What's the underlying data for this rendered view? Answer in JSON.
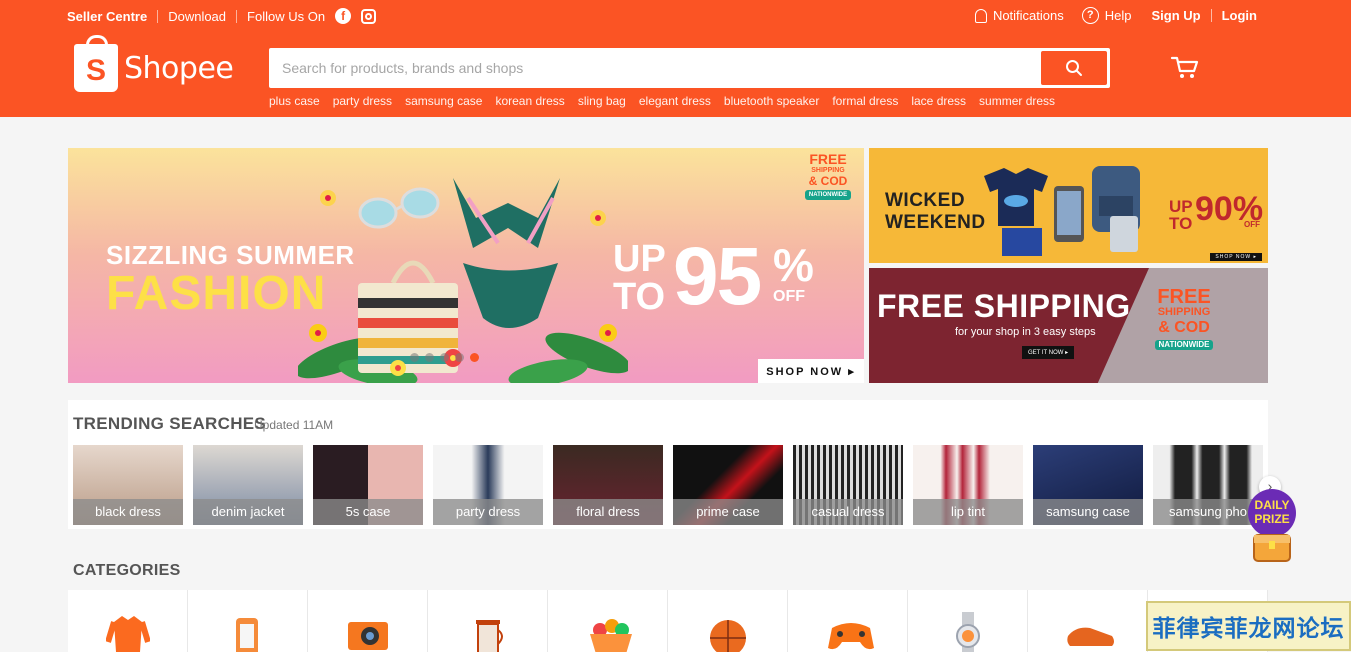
{
  "topbar": {
    "seller_centre": "Seller Centre",
    "download": "Download",
    "follow_us": "Follow Us On",
    "notifications": "Notifications",
    "help": "Help",
    "sign_up": "Sign Up",
    "login": "Login"
  },
  "logo": {
    "mark": "S",
    "word": "Shopee"
  },
  "search": {
    "placeholder": "Search for products, brands and shops",
    "suggestions": [
      "plus case",
      "party dress",
      "samsung case",
      "korean dress",
      "sling bag",
      "elegant dress",
      "bluetooth speaker",
      "formal dress",
      "lace dress",
      "summer dress"
    ]
  },
  "hero": {
    "line1": "SIZZLING SUMMER",
    "line2": "FASHION",
    "upto_1": "UP",
    "upto_2": "TO",
    "discount": "95",
    "percent": "%",
    "off": "OFF",
    "shop_now": "SHOP NOW ▸",
    "badge_1": "FREE",
    "badge_2": "SHIPPING",
    "badge_3": "& COD",
    "badge_4": "NATIONWIDE",
    "slides": 5,
    "active_slide": 5
  },
  "side_banner_1": {
    "line1": "WICKED",
    "line2": "WEEKEND",
    "up": "UP",
    "to": "TO",
    "discount": "90%",
    "off": "OFF",
    "shop_now": "SHOP NOW ▸"
  },
  "side_banner_2": {
    "title": "FREE SHIPPING",
    "subtitle": "for your shop in 3 easy steps",
    "button": "GET IT NOW ▸",
    "badge_1": "FREE",
    "badge_2": "SHIPPING",
    "badge_3": "& COD",
    "badge_4": "NATIONWIDE"
  },
  "trending": {
    "title": "TRENDING SEARCHES",
    "updated": "Updated 11AM",
    "items": [
      {
        "label": "black dress",
        "color": "#d9c9be"
      },
      {
        "label": "denim jacket",
        "color": "#cfc9c4"
      },
      {
        "label": "5s case",
        "color": "#3a2a30"
      },
      {
        "label": "party dress",
        "color": "#f1f1f1"
      },
      {
        "label": "floral dress",
        "color": "#6a2230"
      },
      {
        "label": "prime case",
        "color": "#141414"
      },
      {
        "label": "casual dress",
        "color": "#b9b3a8"
      },
      {
        "label": "lip tint",
        "color": "#f7f1ee"
      },
      {
        "label": "samsung case",
        "color": "#1d2c5c"
      },
      {
        "label": "samsung pho",
        "color": "#e9e9e9"
      }
    ]
  },
  "daily_prize": {
    "line1": "DAILY",
    "line2": "PRIZE"
  },
  "categories": {
    "title": "CATEGORIES",
    "icons": [
      "shirt-icon",
      "phone-case-icon",
      "camera-icon",
      "coffee-press-icon",
      "fruit-basket-icon",
      "basketball-icon",
      "gamepad-icon",
      "watch-icon",
      "shoe-icon",
      "misc-icon"
    ]
  },
  "watermark": "菲律宾菲龙网论坛",
  "colors": {
    "brand": "#fb5424",
    "background": "#f5f5f5"
  }
}
